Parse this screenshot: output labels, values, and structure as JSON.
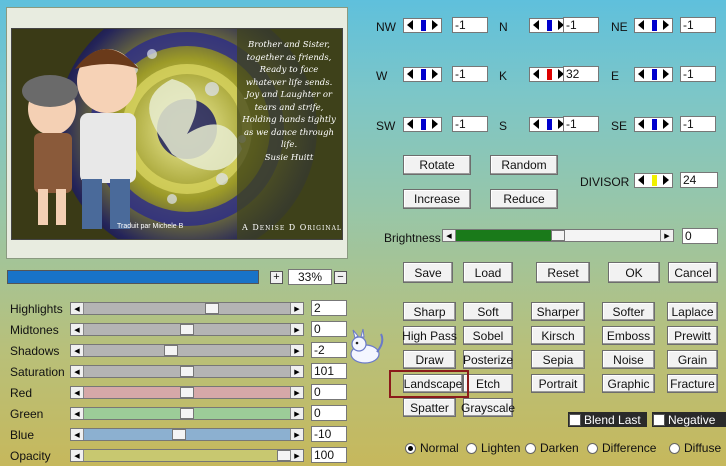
{
  "preview": {
    "poem": [
      "Brother and Sister,",
      "together as friends,",
      "Ready to face",
      "whatever life sends.",
      "Joy and Laughter or",
      "tears and strife,",
      "Holding hands tightly",
      "as we dance through life.",
      "Susie Huitt"
    ],
    "credit_left": "Traduit par Michele B",
    "credit_right": "A Denise D Original"
  },
  "zoom": {
    "plus": "+",
    "value": "33%",
    "minus": "−",
    "progress": 1.0
  },
  "adjust": {
    "rows": [
      {
        "label": "Highlights",
        "value": "2",
        "level": 0.62,
        "color": "#b4b4b4"
      },
      {
        "label": "Midtones",
        "value": "0",
        "level": 0.5,
        "color": "#b4b4b4"
      },
      {
        "label": "Shadows",
        "value": "-2",
        "level": 0.42,
        "color": "#b4b4b4"
      },
      {
        "label": "Saturation",
        "value": "101",
        "level": 0.5,
        "color": "#b4b4b4"
      },
      {
        "label": "Red",
        "value": "0",
        "level": 0.5,
        "color": "#d6a8a8"
      },
      {
        "label": "Green",
        "value": "0",
        "level": 0.5,
        "color": "#9ccc98"
      },
      {
        "label": "Blue",
        "value": "-10",
        "level": 0.46,
        "color": "#8cb0d0"
      },
      {
        "label": "Opacity",
        "value": "100",
        "level": 1.0,
        "color": "#c8c870"
      }
    ]
  },
  "kernel": [
    {
      "label": "NW",
      "value": "-1",
      "color": "#0000cc"
    },
    {
      "label": "N",
      "value": "-1",
      "color": "#0000cc"
    },
    {
      "label": "NE",
      "value": "-1",
      "color": "#0000cc"
    },
    {
      "label": "W",
      "value": "-1",
      "color": "#0000cc"
    },
    {
      "label": "K",
      "value": "32",
      "color": "#dd0000"
    },
    {
      "label": "E",
      "value": "-1",
      "color": "#0000cc"
    },
    {
      "label": "SW",
      "value": "-1",
      "color": "#0000cc"
    },
    {
      "label": "S",
      "value": "-1",
      "color": "#0000cc"
    },
    {
      "label": "SE",
      "value": "-1",
      "color": "#0000cc"
    }
  ],
  "actions": {
    "rotate": "Rotate",
    "random": "Random",
    "increase": "Increase",
    "reduce": "Reduce"
  },
  "divisor": {
    "label": "DIVISOR",
    "value": "24",
    "color": "#f0f000"
  },
  "brightness": {
    "label": "Brightness",
    "value": "0",
    "level": 0.5,
    "color": "#1a7a1a"
  },
  "file": {
    "save": "Save",
    "load": "Load",
    "reset": "Reset",
    "ok": "OK",
    "cancel": "Cancel"
  },
  "presets": [
    "Sharp",
    "Soft",
    "Sharper",
    "Softer",
    "Laplace",
    "High Pass",
    "Sobel",
    "Kirsch",
    "Emboss",
    "Prewitt",
    "Draw",
    "Posterize",
    "Sepia",
    "Noise",
    "Grain",
    "Landscape",
    "Etch",
    "Portrait",
    "Graphic",
    "Fracture",
    "Spatter",
    "Grayscale"
  ],
  "options": {
    "blend_last": "Blend Last",
    "negative": "Negative"
  },
  "modes": {
    "selected": "Normal",
    "items": [
      "Normal",
      "Lighten",
      "Darken",
      "Difference",
      "Diffuse"
    ]
  }
}
